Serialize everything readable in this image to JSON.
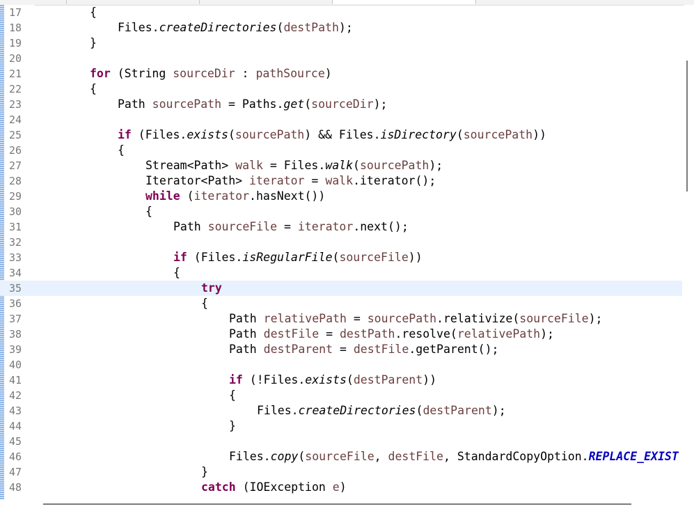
{
  "editor": {
    "current_line": "35",
    "lines": [
      {
        "num": "17",
        "indent": 0,
        "tokens": [
          {
            "t": "{",
            "c": ""
          }
        ]
      },
      {
        "num": "18",
        "indent": 1,
        "tokens": [
          {
            "t": "Files.",
            "c": ""
          },
          {
            "t": "createDirectories",
            "c": "it"
          },
          {
            "t": "(",
            "c": ""
          },
          {
            "t": "destPath",
            "c": "var"
          },
          {
            "t": ");",
            "c": ""
          }
        ]
      },
      {
        "num": "19",
        "indent": 0,
        "tokens": [
          {
            "t": "}",
            "c": ""
          }
        ]
      },
      {
        "num": "20",
        "indent": 0,
        "tokens": []
      },
      {
        "num": "21",
        "indent": 0,
        "tokens": [
          {
            "t": "for",
            "c": "kw"
          },
          {
            "t": " (String ",
            "c": ""
          },
          {
            "t": "sourceDir",
            "c": "var"
          },
          {
            "t": " : ",
            "c": ""
          },
          {
            "t": "pathSource",
            "c": "var"
          },
          {
            "t": ")",
            "c": ""
          }
        ]
      },
      {
        "num": "22",
        "indent": 0,
        "tokens": [
          {
            "t": "{",
            "c": ""
          }
        ]
      },
      {
        "num": "23",
        "indent": 1,
        "tokens": [
          {
            "t": "Path ",
            "c": ""
          },
          {
            "t": "sourcePath",
            "c": "var"
          },
          {
            "t": " = Paths.",
            "c": ""
          },
          {
            "t": "get",
            "c": "it"
          },
          {
            "t": "(",
            "c": ""
          },
          {
            "t": "sourceDir",
            "c": "var"
          },
          {
            "t": ");",
            "c": ""
          }
        ]
      },
      {
        "num": "24",
        "indent": 0,
        "tokens": []
      },
      {
        "num": "25",
        "indent": 1,
        "tokens": [
          {
            "t": "if",
            "c": "kw"
          },
          {
            "t": " (Files.",
            "c": ""
          },
          {
            "t": "exists",
            "c": "it"
          },
          {
            "t": "(",
            "c": ""
          },
          {
            "t": "sourcePath",
            "c": "var"
          },
          {
            "t": ") && Files.",
            "c": ""
          },
          {
            "t": "isDirectory",
            "c": "it"
          },
          {
            "t": "(",
            "c": ""
          },
          {
            "t": "sourcePath",
            "c": "var"
          },
          {
            "t": "))",
            "c": ""
          }
        ]
      },
      {
        "num": "26",
        "indent": 1,
        "tokens": [
          {
            "t": "{",
            "c": ""
          }
        ]
      },
      {
        "num": "27",
        "indent": 2,
        "tokens": [
          {
            "t": "Stream<Path> ",
            "c": ""
          },
          {
            "t": "walk",
            "c": "var"
          },
          {
            "t": " = Files.",
            "c": ""
          },
          {
            "t": "walk",
            "c": "it"
          },
          {
            "t": "(",
            "c": ""
          },
          {
            "t": "sourcePath",
            "c": "var"
          },
          {
            "t": ");",
            "c": ""
          }
        ]
      },
      {
        "num": "28",
        "indent": 2,
        "tokens": [
          {
            "t": "Iterator<Path> ",
            "c": ""
          },
          {
            "t": "iterator",
            "c": "var"
          },
          {
            "t": " = ",
            "c": ""
          },
          {
            "t": "walk",
            "c": "var"
          },
          {
            "t": ".iterator();",
            "c": ""
          }
        ]
      },
      {
        "num": "29",
        "indent": 2,
        "tokens": [
          {
            "t": "while",
            "c": "kw"
          },
          {
            "t": " (",
            "c": ""
          },
          {
            "t": "iterator",
            "c": "var"
          },
          {
            "t": ".hasNext())",
            "c": ""
          }
        ]
      },
      {
        "num": "30",
        "indent": 2,
        "tokens": [
          {
            "t": "{",
            "c": ""
          }
        ]
      },
      {
        "num": "31",
        "indent": 3,
        "tokens": [
          {
            "t": "Path ",
            "c": ""
          },
          {
            "t": "sourceFile",
            "c": "var"
          },
          {
            "t": " = ",
            "c": ""
          },
          {
            "t": "iterator",
            "c": "var"
          },
          {
            "t": ".next();",
            "c": ""
          }
        ]
      },
      {
        "num": "32",
        "indent": 0,
        "tokens": []
      },
      {
        "num": "33",
        "indent": 3,
        "tokens": [
          {
            "t": "if",
            "c": "kw"
          },
          {
            "t": " (Files.",
            "c": ""
          },
          {
            "t": "isRegularFile",
            "c": "it"
          },
          {
            "t": "(",
            "c": ""
          },
          {
            "t": "sourceFile",
            "c": "var"
          },
          {
            "t": "))",
            "c": ""
          }
        ]
      },
      {
        "num": "34",
        "indent": 3,
        "tokens": [
          {
            "t": "{",
            "c": ""
          }
        ]
      },
      {
        "num": "35",
        "indent": 4,
        "tokens": [
          {
            "t": "try",
            "c": "kw"
          }
        ]
      },
      {
        "num": "36",
        "indent": 4,
        "tokens": [
          {
            "t": "{",
            "c": ""
          }
        ]
      },
      {
        "num": "37",
        "indent": 5,
        "tokens": [
          {
            "t": "Path ",
            "c": ""
          },
          {
            "t": "relativePath",
            "c": "var"
          },
          {
            "t": " = ",
            "c": ""
          },
          {
            "t": "sourcePath",
            "c": "var"
          },
          {
            "t": ".relativize(",
            "c": ""
          },
          {
            "t": "sourceFile",
            "c": "var"
          },
          {
            "t": ");",
            "c": ""
          }
        ]
      },
      {
        "num": "38",
        "indent": 5,
        "tokens": [
          {
            "t": "Path ",
            "c": ""
          },
          {
            "t": "destFile",
            "c": "var"
          },
          {
            "t": " = ",
            "c": ""
          },
          {
            "t": "destPath",
            "c": "var"
          },
          {
            "t": ".resolve(",
            "c": ""
          },
          {
            "t": "relativePath",
            "c": "var"
          },
          {
            "t": ");",
            "c": ""
          }
        ]
      },
      {
        "num": "39",
        "indent": 5,
        "tokens": [
          {
            "t": "Path ",
            "c": ""
          },
          {
            "t": "destParent",
            "c": "var"
          },
          {
            "t": " = ",
            "c": ""
          },
          {
            "t": "destFile",
            "c": "var"
          },
          {
            "t": ".getParent();",
            "c": ""
          }
        ]
      },
      {
        "num": "40",
        "indent": 0,
        "tokens": []
      },
      {
        "num": "41",
        "indent": 5,
        "tokens": [
          {
            "t": "if",
            "c": "kw"
          },
          {
            "t": " (!Files.",
            "c": ""
          },
          {
            "t": "exists",
            "c": "it"
          },
          {
            "t": "(",
            "c": ""
          },
          {
            "t": "destParent",
            "c": "var"
          },
          {
            "t": "))",
            "c": ""
          }
        ]
      },
      {
        "num": "42",
        "indent": 5,
        "tokens": [
          {
            "t": "{",
            "c": ""
          }
        ]
      },
      {
        "num": "43",
        "indent": 6,
        "tokens": [
          {
            "t": "Files.",
            "c": ""
          },
          {
            "t": "createDirectories",
            "c": "it"
          },
          {
            "t": "(",
            "c": ""
          },
          {
            "t": "destParent",
            "c": "var"
          },
          {
            "t": ");",
            "c": ""
          }
        ]
      },
      {
        "num": "44",
        "indent": 5,
        "tokens": [
          {
            "t": "}",
            "c": ""
          }
        ]
      },
      {
        "num": "45",
        "indent": 0,
        "tokens": []
      },
      {
        "num": "46",
        "indent": 5,
        "tokens": [
          {
            "t": "Files.",
            "c": ""
          },
          {
            "t": "copy",
            "c": "it"
          },
          {
            "t": "(",
            "c": ""
          },
          {
            "t": "sourceFile",
            "c": "var"
          },
          {
            "t": ", ",
            "c": ""
          },
          {
            "t": "destFile",
            "c": "var"
          },
          {
            "t": ", StandardCopyOption.",
            "c": ""
          },
          {
            "t": "REPLACE_EXIST",
            "c": "const"
          }
        ]
      },
      {
        "num": "47",
        "indent": 4,
        "tokens": [
          {
            "t": "}",
            "c": ""
          }
        ]
      },
      {
        "num": "48",
        "indent": 4,
        "tokens": [
          {
            "t": "catch",
            "c": "kw"
          },
          {
            "t": " (IOException ",
            "c": ""
          },
          {
            "t": "e",
            "c": "var"
          },
          {
            "t": ")",
            "c": ""
          }
        ]
      }
    ]
  },
  "colors": {
    "keyword": "#7f0055",
    "variable": "#6a3e3e",
    "constant": "#0000c0",
    "line_number": "#787878",
    "current_line_bg": "#e8f2fe"
  }
}
